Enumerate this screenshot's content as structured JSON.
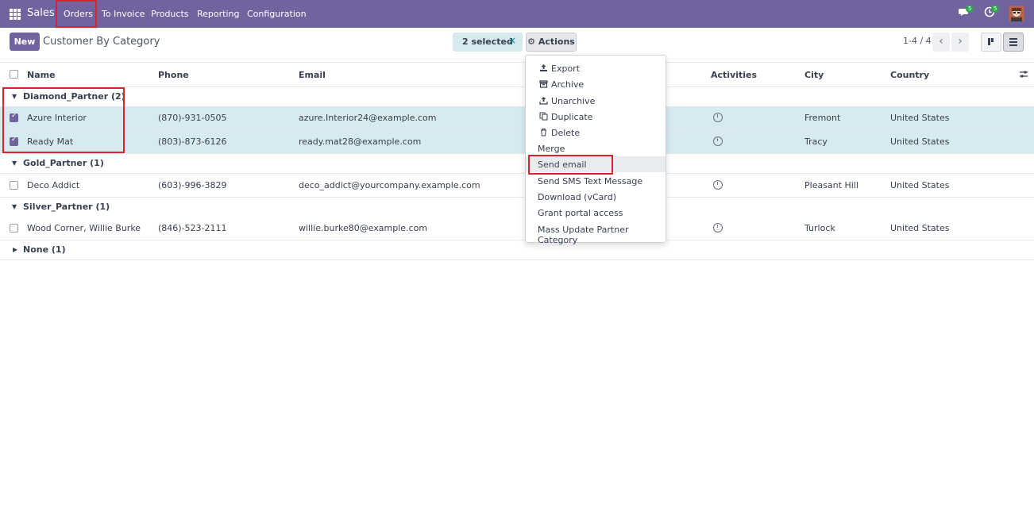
{
  "navbar": {
    "app_name": "Sales",
    "items": [
      "Orders",
      "To Invoice",
      "Products",
      "Reporting",
      "Configuration"
    ],
    "messages_badge": "5",
    "activities_badge": "5"
  },
  "control": {
    "new_label": "New",
    "title": "Customer By Category",
    "selected_label": "2 selected",
    "clear_selection": "×",
    "actions_label": "Actions",
    "pager": "1-4 / 4"
  },
  "columns": [
    "Name",
    "Phone",
    "Email",
    "Activities",
    "City",
    "Country"
  ],
  "groups": [
    {
      "label": "Diamond_Partner (2)",
      "rows": [
        {
          "name": "Azure Interior",
          "phone": "(870)-931-0505",
          "email": "azure.Interior24@example.com",
          "city": "Fremont",
          "country": "United States",
          "selected": true
        },
        {
          "name": "Ready Mat",
          "phone": "(803)-873-6126",
          "email": "ready.mat28@example.com",
          "city": "Tracy",
          "country": "United States",
          "selected": true
        }
      ]
    },
    {
      "label": "Gold_Partner (1)",
      "rows": [
        {
          "name": "Deco Addict",
          "phone": "(603)-996-3829",
          "email": "deco_addict@yourcompany.example.com",
          "city": "Pleasant Hill",
          "country": "United States",
          "selected": false
        }
      ]
    },
    {
      "label": "Silver_Partner (1)",
      "rows": [
        {
          "name": "Wood Corner, Willie Burke",
          "phone": "(846)-523-2111",
          "email": "willie.burke80@example.com",
          "city": "Turlock",
          "country": "United States",
          "selected": false
        }
      ]
    },
    {
      "label": "None (1)",
      "rows": []
    }
  ],
  "actions_menu": [
    {
      "label": "Export",
      "icon": "upload-icon"
    },
    {
      "label": "Archive",
      "icon": "archive-icon"
    },
    {
      "label": "Unarchive",
      "icon": "unarchive-icon"
    },
    {
      "label": "Duplicate",
      "icon": "copy-icon"
    },
    {
      "label": "Delete",
      "icon": "trash-icon"
    },
    {
      "label": "Merge",
      "icon": ""
    },
    {
      "label": "Send email",
      "icon": ""
    },
    {
      "label": "Send SMS Text Message",
      "icon": ""
    },
    {
      "label": "Download (vCard)",
      "icon": ""
    },
    {
      "label": "Grant portal access",
      "icon": ""
    },
    {
      "label": "Mass Update Partner Category",
      "icon": ""
    }
  ],
  "colors": {
    "brand": "#71639e",
    "selected_row": "#d7eaf0",
    "highlight": "#d9232e"
  }
}
